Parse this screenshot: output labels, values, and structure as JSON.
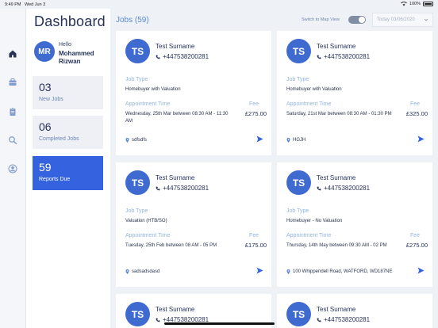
{
  "status_bar": {
    "time": "9:49 PM",
    "date": "Wed Jun 3",
    "battery": "100%"
  },
  "nav": {
    "icons": [
      "home-icon",
      "briefcase-icon",
      "clipboard-icon",
      "search-icon",
      "user-icon"
    ],
    "active_color": "#26325a",
    "icon_color": "#7f9bd0"
  },
  "sidebar": {
    "title": "Dashboard",
    "user": {
      "initials": "MR",
      "greeting": "Hello",
      "name": "Mohammed Rizwan"
    },
    "stats": [
      {
        "number": "03",
        "label": "New Jobs"
      },
      {
        "number": "06",
        "label": "Completed Jobs"
      },
      {
        "number": "59",
        "label": "Reports Due"
      }
    ]
  },
  "jobs_header": {
    "title": "Jobs (59)",
    "map_toggle_label": "Switch to Map View",
    "date_filter": "Today 03/06/2020"
  },
  "job_labels": {
    "job_type": "Job Type",
    "appointment_time": "Appointment Time",
    "fee": "Fee"
  },
  "jobs": [
    {
      "initials": "TS",
      "name": "Test Surname",
      "phone": "+447538200281",
      "job_type": "Homebuyer with Valuation",
      "appointment": "Wednesday, 25th Mar between 08:30 AM - 11:30 AM",
      "fee": "£275.00",
      "location": "sdfsdfs"
    },
    {
      "initials": "TS",
      "name": "Test Surname",
      "phone": "+447538200281",
      "job_type": "Homebuyer with Valuation",
      "appointment": "Saturday, 21st Mar between 08:30 AM - 01:30 PM",
      "fee": "£325.00",
      "location": "HGJH"
    },
    {
      "initials": "TS",
      "name": "Test Surname",
      "phone": "+447538200281",
      "job_type": "Valuation (HTB/SO)",
      "appointment": "Tuesday, 25th Feb between 08 AM - 05 PM",
      "fee": "£175.00",
      "location": "sadsadsdasd"
    },
    {
      "initials": "TS",
      "name": "Test Surname",
      "phone": "+447538200281",
      "job_type": "Homebuyer - No Valuation",
      "appointment": "Thursday, 14th May between 09:30 AM - 02 PM",
      "fee": "£275.00",
      "location": "100 Whippendell Road, WATFORD, WD187NE"
    },
    {
      "initials": "TS",
      "name": "Test Surname",
      "phone": "+447538200281"
    },
    {
      "initials": "TS",
      "name": "Test Surname",
      "phone": "+447538200281"
    }
  ],
  "colors": {
    "accent": "#3563df",
    "avatar": "#3f6bd1",
    "label": "#93b6e0",
    "background": "#eef1f6"
  }
}
